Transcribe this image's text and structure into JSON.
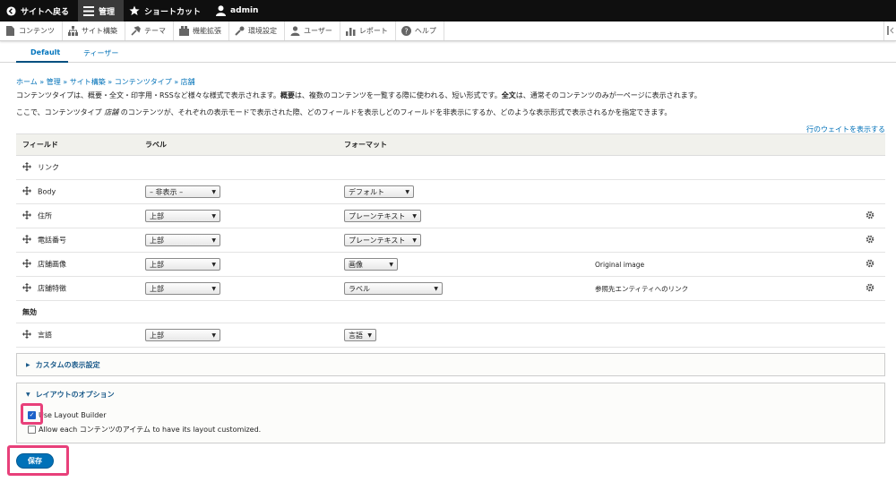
{
  "toolbar": {
    "back_label": "サイトへ戻る",
    "manage_label": "管理",
    "shortcuts_label": "ショートカット",
    "user_label": "admin"
  },
  "admin_menu": [
    {
      "label": "コンテンツ",
      "icon": "content-icon"
    },
    {
      "label": "サイト構築",
      "icon": "structure-icon"
    },
    {
      "label": "テーマ",
      "icon": "appearance-icon"
    },
    {
      "label": "機能拡張",
      "icon": "extend-icon"
    },
    {
      "label": "環境設定",
      "icon": "config-icon"
    },
    {
      "label": "ユーザー",
      "icon": "people-icon"
    },
    {
      "label": "レポート",
      "icon": "reports-icon"
    },
    {
      "label": "ヘルプ",
      "icon": "help-icon"
    }
  ],
  "tabs": [
    {
      "label": "Default",
      "active": true
    },
    {
      "label": "ティーザー",
      "active": false
    }
  ],
  "breadcrumb": "ホーム » 管理 » サイト構築 » コンテンツタイプ » 店舗",
  "description1": {
    "p1": "コンテンツタイプは、概要・全文・印字用・RSSなど様々な様式で表示されます。",
    "b1": "概要",
    "p2": "は、複数のコンテンツを一覧する際に使われる、短い形式です。",
    "b2": "全文",
    "p3": "は、通常そのコンテンツのみが一ページに表示されます。"
  },
  "description2": {
    "p1": "ここで、コンテンツタイプ ",
    "em": "店舗",
    "p2": " のコンテンツが、それぞれの表示モードで表示された際、どのフィールドを表示しどのフィールドを非表示にするか、どのような表示形式で表示されるかを指定できます。"
  },
  "show_weights_link": "行のウェイトを表示する",
  "table": {
    "headers": {
      "field": "フィールド",
      "label": "ラベル",
      "format": "フォーマット"
    },
    "rows": [
      {
        "field": "リンク",
        "label": "",
        "format": "",
        "summary": "",
        "gear": false
      },
      {
        "field": "Body",
        "label": "– 非表示 –",
        "format": "デフォルト",
        "summary": "",
        "gear": false
      },
      {
        "field": "住所",
        "label": "上部",
        "format": "プレーンテキスト",
        "summary": "",
        "gear": true
      },
      {
        "field": "電話番号",
        "label": "上部",
        "format": "プレーンテキスト",
        "summary": "",
        "gear": true
      },
      {
        "field": "店舗画像",
        "label": "上部",
        "format": "画像",
        "summary": "Original image",
        "gear": true
      },
      {
        "field": "店舗特徴",
        "label": "上部",
        "format": "ラベル",
        "summary": "参照先エンティティへのリンク",
        "gear": true
      }
    ],
    "disabled_region": "無効",
    "disabled_rows": [
      {
        "field": "言語",
        "label": "上部",
        "format": "言語"
      }
    ]
  },
  "custom_display": {
    "title": "カスタムの表示設定"
  },
  "layout_options": {
    "title": "レイアウトのオプション",
    "use_layout_builder": {
      "label": "Use Layout Builder",
      "checked": true
    },
    "allow_each": {
      "label": "Allow each コンテンツのアイテム to have its layout customized.",
      "checked": false
    }
  },
  "save_label": "保存",
  "colors": {
    "accent": "#0071b8",
    "highlight": "#e8407a",
    "toolbar": "#0f0f0f"
  }
}
